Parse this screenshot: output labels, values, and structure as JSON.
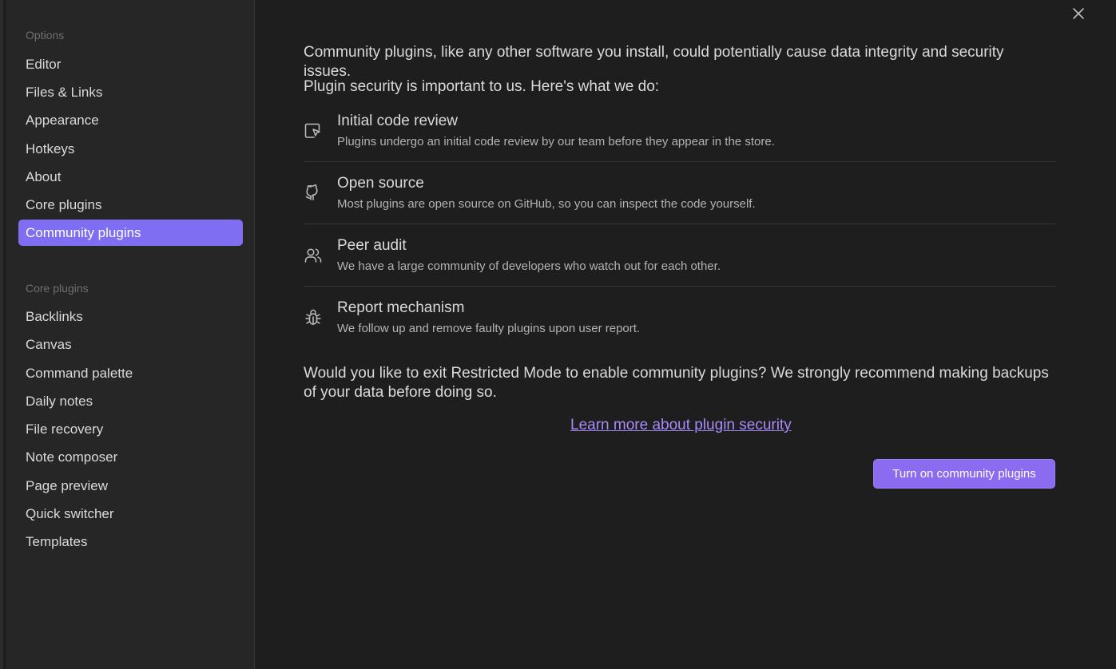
{
  "sidebar": {
    "options_title": "Options",
    "options_items": [
      {
        "label": "Editor"
      },
      {
        "label": "Files & Links"
      },
      {
        "label": "Appearance"
      },
      {
        "label": "Hotkeys"
      },
      {
        "label": "About"
      },
      {
        "label": "Core plugins"
      },
      {
        "label": "Community plugins",
        "active": true
      }
    ],
    "core_title": "Core plugins",
    "core_items": [
      {
        "label": "Backlinks"
      },
      {
        "label": "Canvas"
      },
      {
        "label": "Command palette"
      },
      {
        "label": "Daily notes"
      },
      {
        "label": "File recovery"
      },
      {
        "label": "Note composer"
      },
      {
        "label": "Page preview"
      },
      {
        "label": "Quick switcher"
      },
      {
        "label": "Templates"
      }
    ]
  },
  "main": {
    "intro": "Community plugins, like any other software you install, could potentially cause data integrity and security issues.",
    "security_heading": "Plugin security is important to us. Here's what we do:",
    "features": [
      {
        "icon": "code-review-icon",
        "title": "Initial code review",
        "description": "Plugins undergo an initial code review by our team before they appear in the store."
      },
      {
        "icon": "github-icon",
        "title": "Open source",
        "description": "Most plugins are open source on GitHub, so you can inspect the code yourself."
      },
      {
        "icon": "users-icon",
        "title": "Peer audit",
        "description": "We have a large community of developers who watch out for each other."
      },
      {
        "icon": "bug-icon",
        "title": "Report mechanism",
        "description": "We follow up and remove faulty plugins upon user report."
      }
    ],
    "question": "Would you like to exit Restricted Mode to enable community plugins? We strongly recommend making backups of your data before doing so.",
    "learn_more": "Learn more about plugin security",
    "turn_on_button": "Turn on community plugins"
  },
  "colors": {
    "accent": "#7f6df2",
    "link": "#a88bfa",
    "background": "#1e1e1e",
    "sidebar_background": "#262626"
  }
}
